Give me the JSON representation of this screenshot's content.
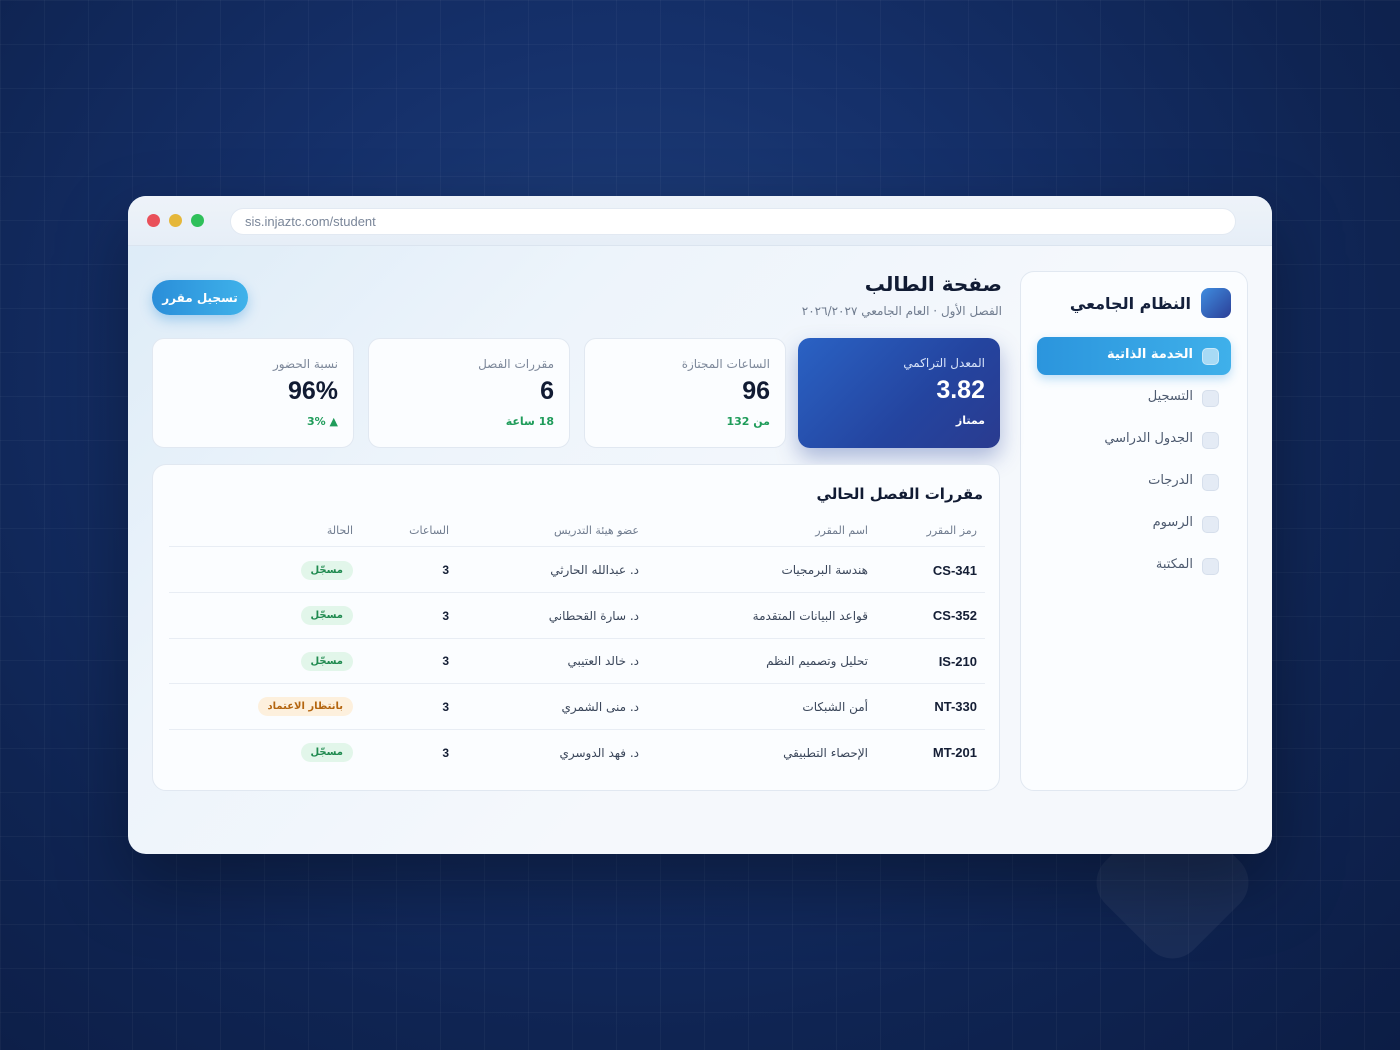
{
  "browser": {
    "url": "sis.injaztc.com/student"
  },
  "sidebar": {
    "brand": "النظام الجامعي",
    "items": [
      {
        "label": "الخدمة الذاتية",
        "active": true
      },
      {
        "label": "التسجيل",
        "active": false
      },
      {
        "label": "الجدول الدراسي",
        "active": false
      },
      {
        "label": "الدرجات",
        "active": false
      },
      {
        "label": "الرسوم",
        "active": false
      },
      {
        "label": "المكتبة",
        "active": false
      }
    ]
  },
  "header": {
    "title": "صفحة الطالب",
    "subtitle": "الفصل الأول · العام الجامعي ٢٠٢٦/٢٠٢٧",
    "register_button": "تسجيل مقرر"
  },
  "stats": [
    {
      "label": "المعدل التراكمي",
      "value": "3.82",
      "note": "ممتاز"
    },
    {
      "label": "الساعات المجتازة",
      "value": "96",
      "note": "من 132"
    },
    {
      "label": "مقررات الفصل",
      "value": "6",
      "note": "18 ساعة"
    },
    {
      "label": "نسبة الحضور",
      "value": "96%",
      "note": "▲ 3%"
    }
  ],
  "courses": {
    "title": "مقررات الفصل الحالي",
    "headers": {
      "code": "رمز المقرر",
      "name": "اسم المقرر",
      "instructor": "عضو هيئة التدريس",
      "hours": "الساعات",
      "status": "الحالة"
    },
    "rows": [
      {
        "code": "CS-341",
        "name": "هندسة البرمجيات",
        "instructor": "د. عبدالله الحارثي",
        "hours": "3",
        "status": "مسجّل",
        "status_type": "ok"
      },
      {
        "code": "CS-352",
        "name": "قواعد البيانات المتقدمة",
        "instructor": "د. سارة القحطاني",
        "hours": "3",
        "status": "مسجّل",
        "status_type": "ok"
      },
      {
        "code": "IS-210",
        "name": "تحليل وتصميم النظم",
        "instructor": "د. خالد العتيبي",
        "hours": "3",
        "status": "مسجّل",
        "status_type": "ok"
      },
      {
        "code": "NT-330",
        "name": "أمن الشبكات",
        "instructor": "د. منى الشمري",
        "hours": "3",
        "status": "بانتظار الاعتماد",
        "status_type": "pending"
      },
      {
        "code": "MT-201",
        "name": "الإحصاء التطبيقي",
        "instructor": "د. فهد الدوسري",
        "hours": "3",
        "status": "مسجّل",
        "status_type": "ok"
      }
    ]
  }
}
